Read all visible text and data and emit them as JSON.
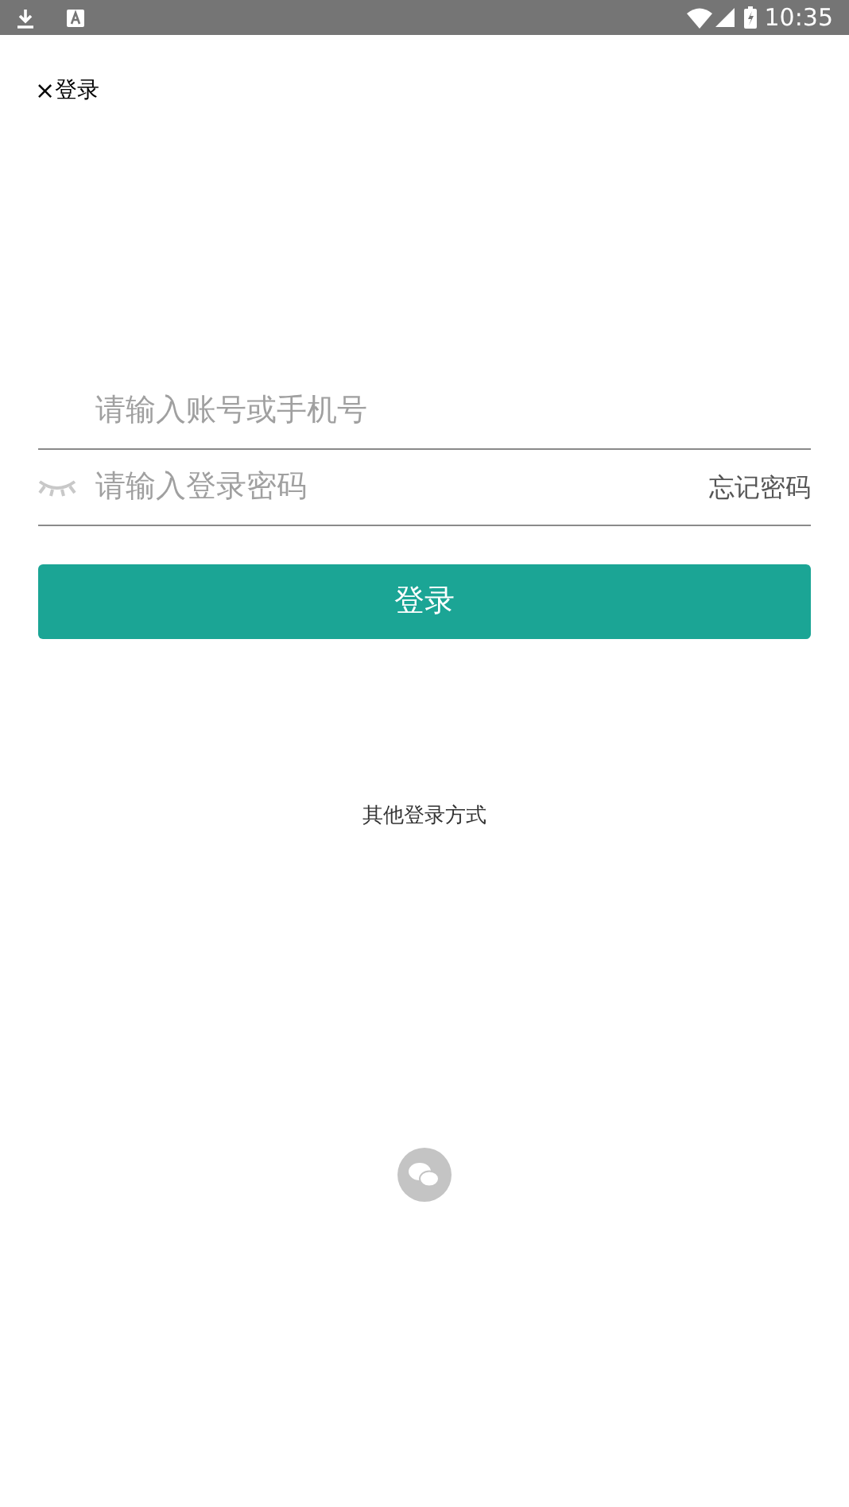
{
  "status_bar": {
    "time": "10:35"
  },
  "header": {
    "close": "×",
    "title": "登录"
  },
  "account_field": {
    "placeholder": "请输入账号或手机号"
  },
  "password_field": {
    "placeholder": "请输入登录密码",
    "forgot": "忘记密码"
  },
  "login_button": "登录",
  "other_login": {
    "label": "其他登录方式"
  }
}
